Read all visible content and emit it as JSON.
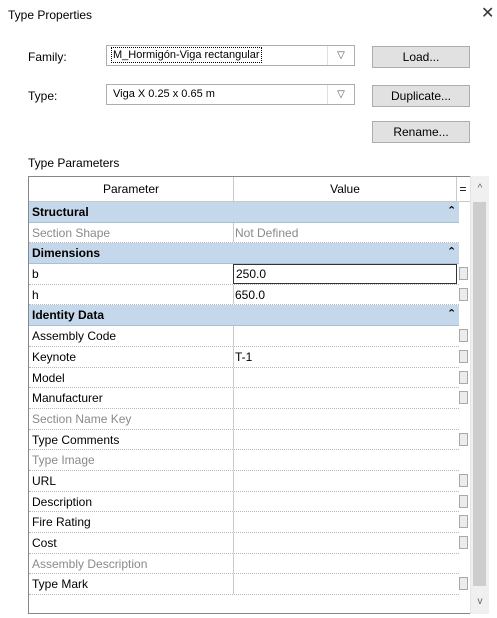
{
  "window": {
    "title": "Type Properties",
    "close_glyph": "✕"
  },
  "family": {
    "label": "Family:",
    "value": "M_Hormigón-Viga rectangular"
  },
  "type": {
    "label": "Type:",
    "value": "Viga X 0.25 x 0.65 m"
  },
  "buttons": {
    "load": "Load...",
    "duplicate": "Duplicate...",
    "rename": "Rename..."
  },
  "type_parameters_label": "Type Parameters",
  "table": {
    "headers": {
      "parameter": "Parameter",
      "value": "Value",
      "sort": "="
    },
    "rows": [
      {
        "kind": "group",
        "parameter": "Structural"
      },
      {
        "kind": "row",
        "parameter": "Section Shape",
        "value": "Not Defined",
        "disabled": true,
        "mini": false
      },
      {
        "kind": "group",
        "parameter": "Dimensions"
      },
      {
        "kind": "row",
        "parameter": "b",
        "value": "250.0",
        "editing": true,
        "mini": true
      },
      {
        "kind": "row",
        "parameter": "h",
        "value": "650.0",
        "mini": true
      },
      {
        "kind": "group",
        "parameter": "Identity Data"
      },
      {
        "kind": "row",
        "parameter": "Assembly Code",
        "value": "",
        "mini": true
      },
      {
        "kind": "row",
        "parameter": "Keynote",
        "value": "T-1",
        "mini": true
      },
      {
        "kind": "row",
        "parameter": "Model",
        "value": "",
        "mini": true
      },
      {
        "kind": "row",
        "parameter": "Manufacturer",
        "value": "",
        "mini": true
      },
      {
        "kind": "row",
        "parameter": "Section Name Key",
        "value": "",
        "disabled": true,
        "mini": false
      },
      {
        "kind": "row",
        "parameter": "Type Comments",
        "value": "",
        "mini": true
      },
      {
        "kind": "row",
        "parameter": "Type Image",
        "value": "",
        "disabled": true,
        "mini": false
      },
      {
        "kind": "row",
        "parameter": "URL",
        "value": "",
        "mini": true
      },
      {
        "kind": "row",
        "parameter": "Description",
        "value": "",
        "mini": true
      },
      {
        "kind": "row",
        "parameter": "Fire Rating",
        "value": "",
        "mini": true
      },
      {
        "kind": "row",
        "parameter": "Cost",
        "value": "",
        "mini": true
      },
      {
        "kind": "row",
        "parameter": "Assembly Description",
        "value": "",
        "disabled": true,
        "mini": false
      },
      {
        "kind": "row",
        "parameter": "Type Mark",
        "value": "",
        "mini": true
      }
    ]
  },
  "scrollbar": {
    "up_glyph": "^",
    "down_glyph": "v"
  }
}
